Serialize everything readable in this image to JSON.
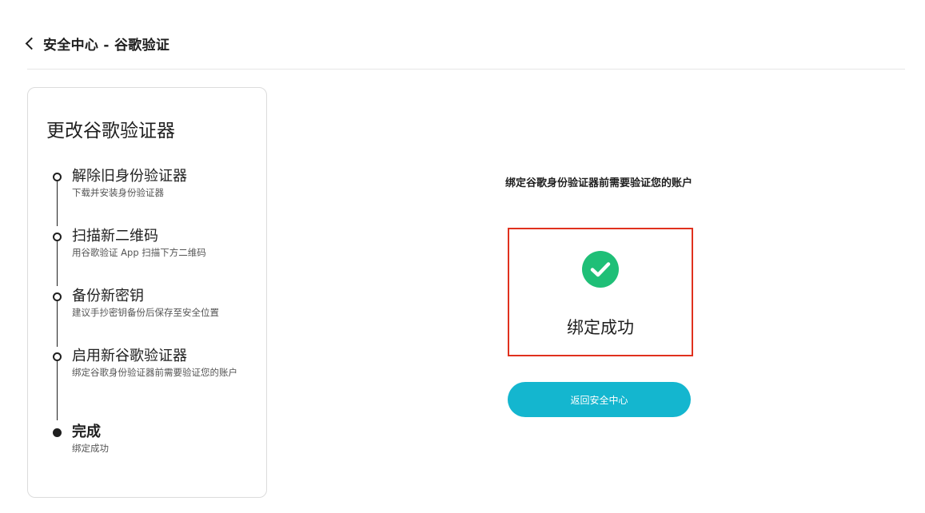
{
  "header": {
    "title": "安全中心 - 谷歌验证"
  },
  "panel": {
    "title": "更改谷歌验证器",
    "steps": [
      {
        "title": "解除旧身份验证器",
        "desc": "下载并安装身份验证器",
        "status": "pending"
      },
      {
        "title": "扫描新二维码",
        "desc": "用谷歌验证 App 扫描下方二维码",
        "status": "pending"
      },
      {
        "title": "备份新密钥",
        "desc": "建议手抄密钥备份后保存至安全位置",
        "status": "pending"
      },
      {
        "title": "启用新谷歌验证器",
        "desc": "绑定谷歌身份验证器前需要验证您的账户",
        "status": "pending"
      },
      {
        "title": "完成",
        "desc": "绑定成功",
        "status": "current"
      }
    ]
  },
  "main": {
    "subtitle": "绑定谷歌身份验证器前需要验证您的账户",
    "success_icon": "check-circle-icon",
    "success_text": "绑定成功",
    "back_button": "返回安全中心"
  },
  "colors": {
    "accent": "#14b6cf",
    "success": "#1fbf77",
    "highlight_border": "#e0311e"
  }
}
